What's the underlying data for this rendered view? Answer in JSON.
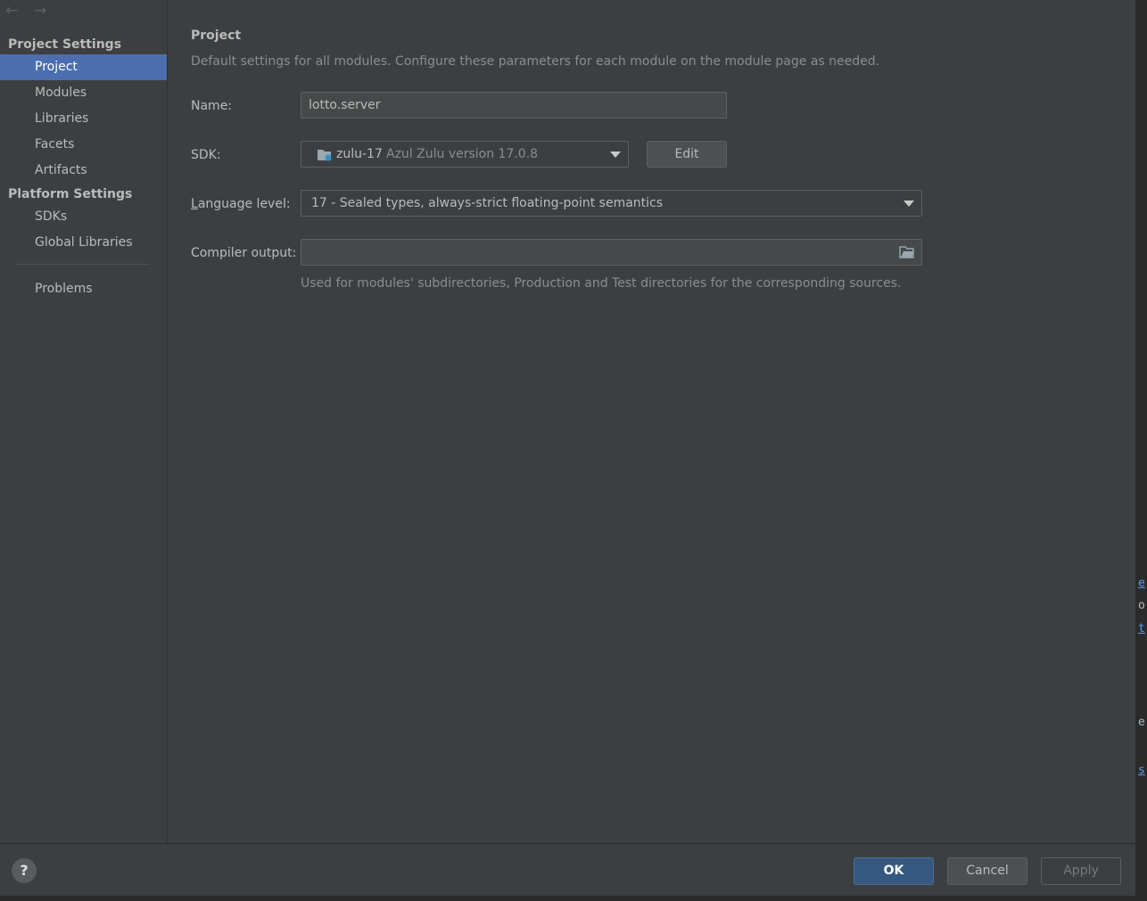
{
  "sidebar": {
    "nav_back_glyph": "←",
    "nav_forward_glyph": "→",
    "project_settings_header": "Project Settings",
    "platform_settings_header": "Platform Settings",
    "items": [
      {
        "label": "Project"
      },
      {
        "label": "Modules"
      },
      {
        "label": "Libraries"
      },
      {
        "label": "Facets"
      },
      {
        "label": "Artifacts"
      },
      {
        "label": "SDKs"
      },
      {
        "label": "Global Libraries"
      },
      {
        "label": "Problems"
      }
    ],
    "selected_item": "Project"
  },
  "main": {
    "title": "Project",
    "description": "Default settings for all modules. Configure these parameters for each module on the module page as needed.",
    "name_label": "Name:",
    "name_value": "lotto.server",
    "sdk_label": "SDK:",
    "sdk_name": "zulu-17",
    "sdk_version": "Azul Zulu version 17.0.8",
    "edit_button": "Edit",
    "language_level_label_mnemonic": "L",
    "language_level_label_rest": "anguage level:",
    "language_level_value": "17 - Sealed types, always-strict floating-point semantics",
    "compiler_output_label": "Compiler output:",
    "compiler_output_value": "",
    "compiler_output_hint": "Used for modules' subdirectories, Production and Test directories for the corresponding sources."
  },
  "footer": {
    "help_glyph": "?",
    "ok": "OK",
    "cancel": "Cancel",
    "apply": "Apply"
  },
  "background_editor": {
    "fragments": [
      "e",
      "o",
      "t",
      "e",
      "s"
    ]
  },
  "colors": {
    "selection": "#4b6eaf",
    "ok_button": "#365880",
    "dialog_bg": "#3c3f41",
    "sdk_icon": "#3592c4"
  }
}
